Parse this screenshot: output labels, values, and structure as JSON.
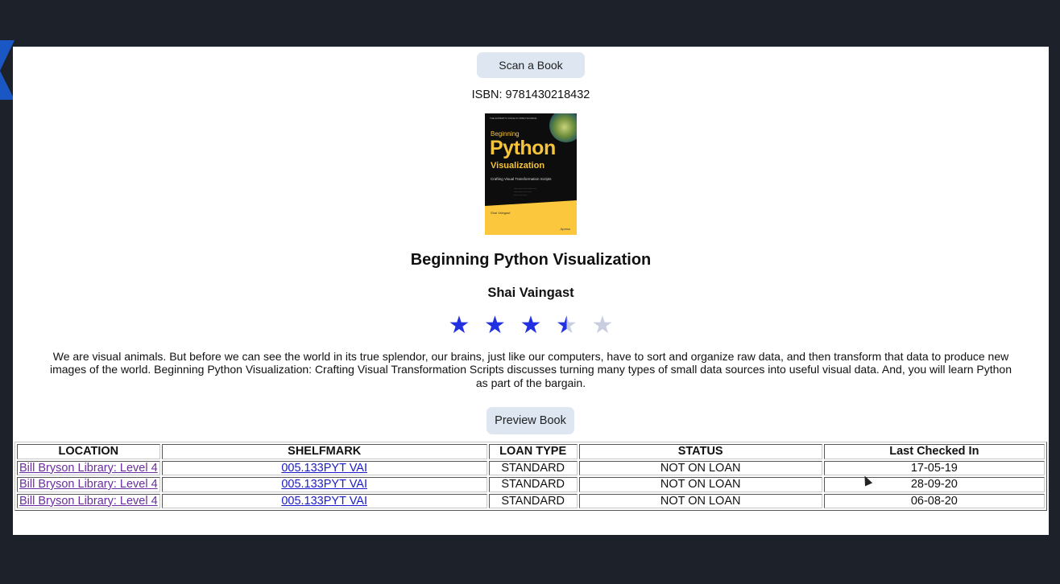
{
  "actions": {
    "scan_label": "Scan a Book",
    "preview_label": "Preview Book"
  },
  "book": {
    "isbn_text": "ISBN: 9781430218432",
    "title": "Beginning Python Visualization",
    "author": "Shai Vaingast",
    "rating": 3.5,
    "rating_max": 5,
    "description": "We are visual animals. But before we can see the world in its true splendor, our brains, just like our computers, have to sort and organize raw data, and then transform that data to produce new images of the world. Beginning Python Visualization: Crafting Visual Transformation Scripts discusses turning many types of small data sources into useful visual data. And, you will learn Python as part of the bargain.",
    "cover": {
      "series": "THE EXPERT'S VOICE IN OPEN SOURCE",
      "line1": "Beginning",
      "line2": "Python",
      "line3": "Visualization",
      "subtitle": "Crafting Visual Transformation Scripts",
      "author": "Shai Vaingast",
      "publisher": "Apress"
    }
  },
  "colors": {
    "star_filled": "#2130e0",
    "star_empty": "#c8cde0",
    "button_bg": "#dde6f1",
    "background": "#1d2129"
  },
  "table": {
    "headers": [
      "LOCATION",
      "SHELFMARK",
      "LOAN TYPE",
      "STATUS",
      "Last Checked In"
    ],
    "rows": [
      [
        "Bill Bryson Library: Level 4",
        "005.133PYT VAI",
        "STANDARD",
        "NOT ON LOAN",
        "17-05-19"
      ],
      [
        "Bill Bryson Library: Level 4",
        "005.133PYT VAI",
        "STANDARD",
        "NOT ON LOAN",
        "28-09-20"
      ],
      [
        "Bill Bryson Library: Level 4",
        "005.133PYT VAI",
        "STANDARD",
        "NOT ON LOAN",
        "06-08-20"
      ]
    ]
  }
}
